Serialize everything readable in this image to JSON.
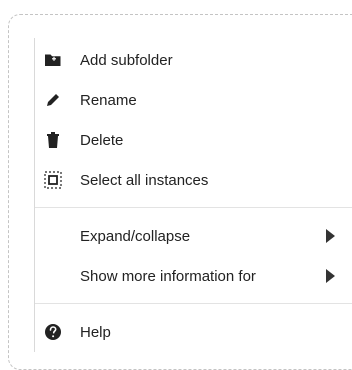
{
  "menu": {
    "items": [
      {
        "label": "Add subfolder",
        "icon": "folder-plus-icon"
      },
      {
        "label": "Rename",
        "icon": "pencil-icon"
      },
      {
        "label": "Delete",
        "icon": "trash-icon"
      },
      {
        "label": "Select all instances",
        "icon": "select-all-icon"
      }
    ],
    "submenus": [
      {
        "label": "Expand/collapse",
        "icon": "chevron-right-icon"
      },
      {
        "label": "Show more information for",
        "icon": "chevron-right-icon"
      }
    ],
    "help": {
      "label": "Help",
      "icon": "question-circle-icon"
    }
  },
  "colors": {
    "text": "#222222",
    "border": "#c4c4c4",
    "separator": "#e3e3e3",
    "icon": "#222222"
  }
}
